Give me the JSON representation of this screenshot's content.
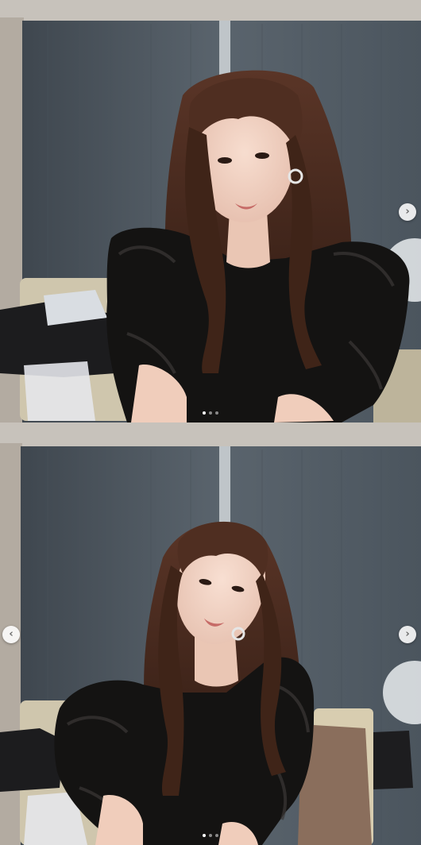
{
  "posts": [
    {
      "photo": {
        "subject": "portrait-black-puff-sleeve-blouse",
        "colors": {
          "wall": "#56606a",
          "dress": "#141312",
          "hair": "#4a2a1e",
          "skin": "#f1d2c2"
        }
      },
      "carousel": {
        "slide_count": 3,
        "active_index": 0,
        "has_prev": false,
        "has_next": true
      },
      "icons": {
        "next": "chevron-right-icon"
      }
    },
    {
      "photo": {
        "subject": "portrait-head-tilted-black-blouse",
        "colors": {
          "wall": "#56606a",
          "dress": "#141312",
          "hair": "#4a2a1e",
          "skin": "#f1d2c2"
        }
      },
      "carousel": {
        "slide_count": 3,
        "active_index": 0,
        "has_prev": true,
        "has_next": true
      },
      "icons": {
        "prev": "chevron-left-icon",
        "next": "chevron-right-icon"
      }
    }
  ]
}
